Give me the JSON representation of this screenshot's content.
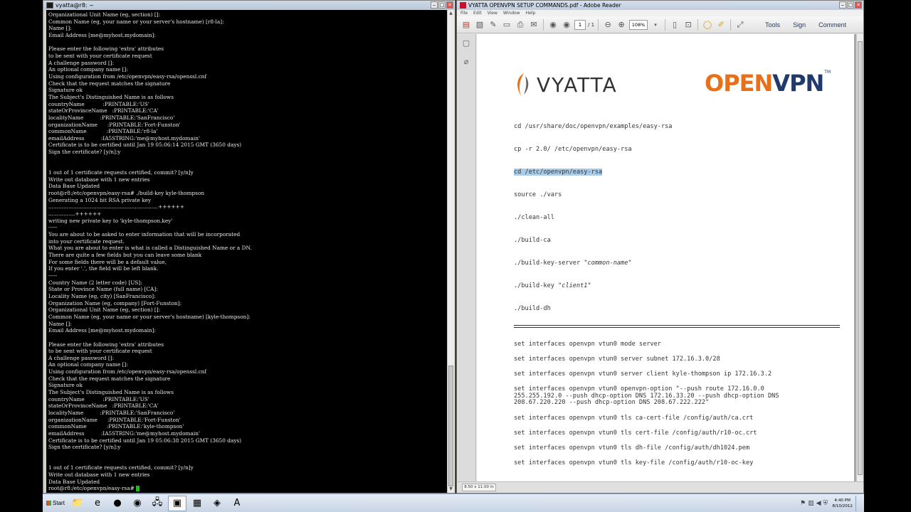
{
  "terminal": {
    "title": "vyatta@r8: ~",
    "lines": [
      "Organizational Unit Name (eg, section) []:",
      "Common Name (eg, your name or your server's hostname) [r8-la]:",
      "Name []:",
      "Email Address [me@myhost.mydomain]:",
      "",
      "Please enter the following 'extra' attributes",
      "to be sent with your certificate request",
      "A challenge password []:",
      "An optional company name []:",
      "Using configuration from /etc/openvpn/easy-rsa/openssl.cnf",
      "Check that the request matches the signature",
      "Signature ok",
      "The Subject's Distinguished Name is as follows",
      "countryName           :PRINTABLE:'US'",
      "stateOrProvinceName   :PRINTABLE:'CA'",
      "localityName          :PRINTABLE:'SanFrancisco'",
      "organizationName      :PRINTABLE:'Fort-Funston'",
      "commonName            :PRINTABLE:'r8-la'",
      "emailAddress          :IA5STRING:'me@myhost.mydomain'",
      "Certificate is to be certified until Jan 19 05:06:14 2015 GMT (3650 days)",
      "Sign the certificate? [y/n]:y",
      "",
      "",
      "1 out of 1 certificate requests certified, commit? [y/n]y",
      "Write out database with 1 new entries",
      "Data Base Updated",
      "root@r8:/etc/openvpn/easy-rsa# ./build-key kyle-thompson",
      "Generating a 1024 bit RSA private key",
      "..................................................................++++++",
      "................++++++",
      "writing new private key to 'kyle-thompson.key'",
      "-----",
      "You are about to be asked to enter information that will be incorporated",
      "into your certificate request.",
      "What you are about to enter is what is called a Distinguished Name or a DN.",
      "There are quite a few fields but you can leave some blank",
      "For some fields there will be a default value,",
      "If you enter '.', the field will be left blank.",
      "-----",
      "Country Name (2 letter code) [US]:",
      "State or Province Name (full name) [CA]:",
      "Locality Name (eg, city) [SanFrancisco]:",
      "Organization Name (eg, company) [Fort-Funston]:",
      "Organizational Unit Name (eg, section) []:",
      "Common Name (eg, your name or your server's hostname) [kyle-thompson]:",
      "Name []:",
      "Email Address [me@myhost.mydomain]:",
      "",
      "Please enter the following 'extra' attributes",
      "to be sent with your certificate request",
      "A challenge password []:",
      "An optional company name []:",
      "Using configuration from /etc/openvpn/easy-rsa/openssl.cnf",
      "Check that the request matches the signature",
      "Signature ok",
      "The Subject's Distinguished Name is as follows",
      "countryName           :PRINTABLE:'US'",
      "stateOrProvinceName   :PRINTABLE:'CA'",
      "localityName          :PRINTABLE:'SanFrancisco'",
      "organizationName      :PRINTABLE:'Fort-Funston'",
      "commonName            :PRINTABLE:'kyle-thompson'",
      "emailAddress          :IA5STRING:'me@myhost.mydomain'",
      "Certificate is to be certified until Jan 19 05:06:38 2015 GMT (3650 days)",
      "Sign the certificate? [y/n]:y",
      "",
      "",
      "1 out of 1 certificate requests certified, commit? [y/n]y",
      "Write out database with 1 new entries",
      "Data Base Updated"
    ],
    "prompt": "root@r8:/etc/openvpn/easy-rsa# "
  },
  "pdf": {
    "title": "VYATTA OPENVPN SETUP COMMANDS.pdf - Adobe Reader",
    "menu": [
      "File",
      "Edit",
      "View",
      "Window",
      "Help"
    ],
    "page_current": "1",
    "page_total": "/ 1",
    "zoom": "108%",
    "tool_links": [
      "Tools",
      "Sign",
      "Comment"
    ],
    "page_size": "8.50 x 11.00 in",
    "logo_vyatta": "VYATTA",
    "logo_openvpn_a": "OPEN",
    "logo_openvpn_b": "VPN",
    "logo_tm": "TM",
    "commands": [
      {
        "text": "cd /usr/share/doc/openvpn/examples/easy-rsa",
        "hl": false
      },
      {
        "text": "cp -r 2.0/ /etc/openvpn/easy-rsa",
        "hl": false
      },
      {
        "text": "cd /etc/openvpn/easy-rsa",
        "hl": true
      },
      {
        "text": "source ./vars",
        "hl": false
      },
      {
        "text": "./clean-all",
        "hl": false
      },
      {
        "text": "./build-ca",
        "hl": false
      },
      {
        "text": "./build-key-server ",
        "italic": "\"common-name\"",
        "hl": false
      },
      {
        "text": "./build-key ",
        "italic": "\"client1\"",
        "hl": false
      },
      {
        "text": "./build-dh",
        "hl": false
      }
    ],
    "set_commands": [
      "set interfaces openvpn vtun0 mode server",
      "set interfaces openvpn vtun0 server subnet 172.16.3.0/28",
      "set interfaces openvpn vtun0 server client kyle-thompson ip 172.16.3.2",
      "set interfaces openvpn vtun0 openvpn-option \"--push route 172.16.0.0\n255.255.192.0 --push dhcp-option DNS 172.16.33.20 --push dhcp-option DNS\n208.67.220.220 --push dhcp-option DNS 208.67.222.222\"",
      "set interfaces openvpn vtun0 tls ca-cert-file /config/auth/ca.crt",
      "set interfaces openvpn vtun0 tls cert-file /config/auth/r10-oc.crt",
      "set interfaces openvpn vtun0 tls dh-file /config/auth/dh1024.pem",
      "set interfaces openvpn vtun0 tls key-file /config/auth/r10-oc-key"
    ]
  },
  "taskbar": {
    "start_label": "Start",
    "apps": [
      {
        "name": "explorer",
        "icon": "📁"
      },
      {
        "name": "ie",
        "icon": "e"
      },
      {
        "name": "chrome",
        "icon": "●"
      },
      {
        "name": "firefox",
        "icon": "◉"
      },
      {
        "name": "network",
        "icon": "🖧"
      },
      {
        "name": "putty",
        "icon": "▣"
      },
      {
        "name": "app7",
        "icon": "▦"
      },
      {
        "name": "app8",
        "icon": "◈"
      },
      {
        "name": "acrobat",
        "icon": "A"
      }
    ],
    "time": "4:40 PM",
    "date": "8/10/2012"
  }
}
